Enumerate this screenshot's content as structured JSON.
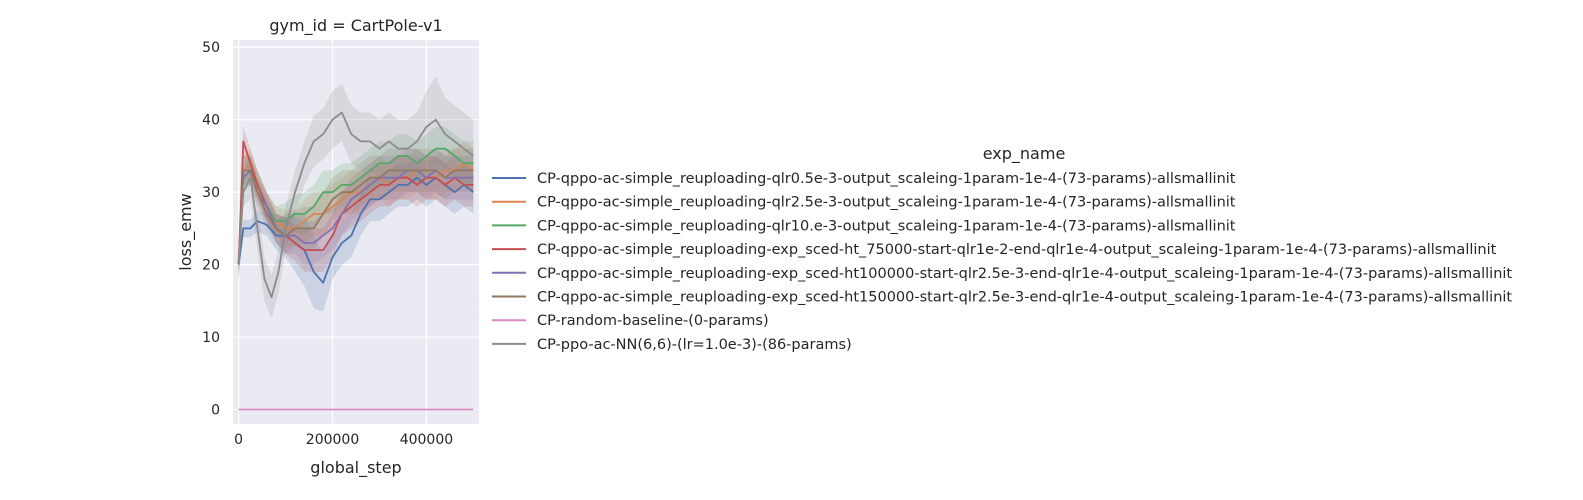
{
  "chart_data": {
    "type": "line",
    "title": "gym_id = CartPole-v1",
    "xlabel": "global_step",
    "ylabel": "loss_emw",
    "xlim": [
      -12000,
      512000
    ],
    "ylim": [
      -2,
      51
    ],
    "xticks": [
      0,
      200000,
      400000
    ],
    "xtick_labels": [
      "0",
      "200000",
      "400000"
    ],
    "yticks": [
      0,
      10,
      20,
      30,
      40,
      50
    ],
    "ytick_labels": [
      "0",
      "10",
      "20",
      "30",
      "40",
      "50"
    ],
    "grid": true,
    "legend_title": "exp_name",
    "legend_position": "right, outside plot",
    "series": [
      {
        "name": "CP-qppo-ac-simple_reuploading-qlr0.5e-3-output_scaleing-1param-1e-4-(73-params)-allsmallinit",
        "color": "#4c72b0",
        "x": [
          0,
          10000,
          25000,
          40000,
          60000,
          80000,
          100000,
          120000,
          140000,
          160000,
          180000,
          200000,
          220000,
          240000,
          260000,
          280000,
          300000,
          320000,
          340000,
          360000,
          380000,
          400000,
          420000,
          440000,
          460000,
          480000,
          500000
        ],
        "y": [
          20,
          25,
          25,
          26,
          25.5,
          24,
          24,
          23,
          22,
          19,
          17.5,
          21,
          23,
          24,
          27,
          29,
          29,
          30,
          31,
          31,
          32,
          31,
          32,
          31,
          30,
          31,
          30
        ],
        "band": [
          1.5,
          1.2,
          1.2,
          1.5,
          1.5,
          2,
          3,
          4,
          5,
          5,
          4,
          3,
          3,
          3,
          3,
          3,
          3,
          3,
          3,
          3,
          3,
          3,
          3,
          3,
          3,
          3,
          3
        ]
      },
      {
        "name": "CP-qppo-ac-simple_reuploading-qlr2.5e-3-output_scaleing-1param-1e-4-(73-params)-allsmallinit",
        "color": "#dd8452",
        "x": [
          0,
          10000,
          25000,
          40000,
          60000,
          80000,
          100000,
          120000,
          140000,
          160000,
          180000,
          200000,
          220000,
          240000,
          260000,
          280000,
          300000,
          320000,
          340000,
          360000,
          380000,
          400000,
          420000,
          440000,
          460000,
          480000,
          500000
        ],
        "y": [
          20,
          33,
          34,
          31,
          28,
          26,
          25,
          25,
          26,
          27,
          27,
          28,
          29,
          30,
          30,
          31,
          32,
          31,
          32,
          32,
          33,
          32,
          32,
          33,
          33,
          34,
          33
        ],
        "band": [
          2,
          2,
          2,
          2,
          2,
          2,
          2.5,
          2.5,
          3,
          3,
          3,
          3,
          3,
          3,
          3,
          3,
          3,
          3,
          3,
          3,
          3,
          3,
          3,
          3,
          3,
          3,
          3
        ]
      },
      {
        "name": "CP-qppo-ac-simple_reuploading-qlr10.e-3-output_scaleing-1param-1e-4-(73-params)-allsmallinit",
        "color": "#55a868",
        "x": [
          0,
          10000,
          25000,
          40000,
          60000,
          80000,
          100000,
          120000,
          140000,
          160000,
          180000,
          200000,
          220000,
          240000,
          260000,
          280000,
          300000,
          320000,
          340000,
          360000,
          380000,
          400000,
          420000,
          440000,
          460000,
          480000,
          500000
        ],
        "y": [
          20,
          33,
          33,
          31,
          28,
          26,
          26,
          27,
          27,
          28,
          30,
          30,
          31,
          31,
          32,
          33,
          34,
          34,
          35,
          35,
          34,
          35,
          36,
          36,
          35,
          34,
          34
        ],
        "band": [
          2,
          2,
          2,
          2,
          2,
          2,
          2.5,
          2.5,
          3,
          3,
          3,
          3,
          3,
          3,
          3,
          3,
          3,
          3,
          3,
          3,
          3,
          3,
          3,
          3,
          3,
          3,
          3
        ]
      },
      {
        "name": "CP-qppo-ac-simple_reuploading-exp_sced-ht_75000-start-qlr1e-2-end-qlr1e-4-output_scaleing-1param-1e-4-(73-params)-allsmallinit",
        "color": "#c44e52",
        "x": [
          0,
          10000,
          25000,
          40000,
          60000,
          80000,
          100000,
          120000,
          140000,
          160000,
          180000,
          200000,
          220000,
          240000,
          260000,
          280000,
          300000,
          320000,
          340000,
          360000,
          380000,
          400000,
          420000,
          440000,
          460000,
          480000,
          500000
        ],
        "y": [
          20,
          37,
          34,
          31,
          28,
          25,
          24,
          23,
          22,
          22,
          22,
          24,
          27,
          28,
          29,
          30,
          31,
          31,
          32,
          32,
          31,
          32,
          32,
          31,
          32,
          31,
          31
        ],
        "band": [
          2,
          2,
          2,
          2,
          2,
          2,
          2.5,
          2.5,
          3,
          3,
          3,
          3,
          3,
          3,
          3,
          3,
          3,
          3,
          3,
          3,
          3,
          3,
          3,
          3,
          3,
          3,
          3
        ]
      },
      {
        "name": "CP-qppo-ac-simple_reuploading-exp_sced-ht100000-start-qlr2.5e-3-end-qlr1e-4-output_scaleing-1param-1e-4-(73-params)-allsmallinit",
        "color": "#8172b3",
        "x": [
          0,
          10000,
          25000,
          40000,
          60000,
          80000,
          100000,
          120000,
          140000,
          160000,
          180000,
          200000,
          220000,
          240000,
          260000,
          280000,
          300000,
          320000,
          340000,
          360000,
          380000,
          400000,
          420000,
          440000,
          460000,
          480000,
          500000
        ],
        "y": [
          20,
          32,
          33,
          30,
          28,
          25,
          24,
          24,
          23,
          23,
          24,
          25,
          27,
          29,
          30,
          31,
          32,
          32,
          32,
          33,
          33,
          32,
          33,
          32,
          32,
          32,
          32
        ],
        "band": [
          2,
          2,
          2,
          2,
          2,
          2,
          2.5,
          2.5,
          3,
          3,
          3,
          3,
          3,
          3,
          3,
          3,
          3,
          3,
          3,
          3,
          3,
          3,
          3,
          3,
          3,
          3,
          3
        ]
      },
      {
        "name": "CP-qppo-ac-simple_reuploading-exp_sced-ht150000-start-qlr2.5e-3-end-qlr1e-4-output_scaleing-1param-1e-4-(73-params)-allsmallinit",
        "color": "#937860",
        "x": [
          0,
          10000,
          25000,
          40000,
          60000,
          80000,
          100000,
          120000,
          140000,
          160000,
          180000,
          200000,
          220000,
          240000,
          260000,
          280000,
          300000,
          320000,
          340000,
          360000,
          380000,
          400000,
          420000,
          440000,
          460000,
          480000,
          500000
        ],
        "y": [
          20,
          33,
          33,
          30,
          27,
          25,
          24,
          25,
          25,
          25,
          27,
          29,
          30,
          30,
          31,
          32,
          32,
          33,
          33,
          33,
          33,
          33,
          33,
          32,
          33,
          33,
          33
        ],
        "band": [
          2,
          2,
          2,
          2,
          2,
          2,
          2.5,
          2.5,
          3,
          3,
          3,
          3,
          3,
          3,
          3,
          3,
          3,
          3,
          3,
          3,
          3,
          3,
          3,
          3,
          3,
          3,
          3
        ]
      },
      {
        "name": "CP-random-baseline-(0-params)",
        "color": "#da8bc3",
        "x": [
          0,
          500000
        ],
        "y": [
          0,
          0
        ],
        "band": [
          0,
          0
        ]
      },
      {
        "name": "CP-ppo-ac-NN(6,6)-(lr=1.0e-3)-(86-params)",
        "color": "#8c8c8c",
        "x": [
          0,
          10000,
          25000,
          40000,
          55000,
          70000,
          85000,
          100000,
          120000,
          140000,
          160000,
          180000,
          200000,
          220000,
          240000,
          260000,
          280000,
          300000,
          320000,
          340000,
          360000,
          380000,
          400000,
          420000,
          440000,
          460000,
          480000,
          500000
        ],
        "y": [
          20,
          30,
          32,
          25,
          18,
          15.5,
          19,
          25,
          30,
          34,
          37,
          38,
          40,
          41,
          38,
          37,
          37,
          36,
          37,
          36,
          36,
          37,
          39,
          40,
          38,
          37,
          36,
          35
        ],
        "band": [
          2,
          2,
          3,
          3,
          3,
          3,
          3,
          3,
          3,
          3,
          3.5,
          3.5,
          4,
          4,
          4,
          4,
          4,
          4,
          4,
          4,
          4,
          4,
          5,
          6,
          5,
          5,
          5,
          5
        ]
      }
    ]
  }
}
